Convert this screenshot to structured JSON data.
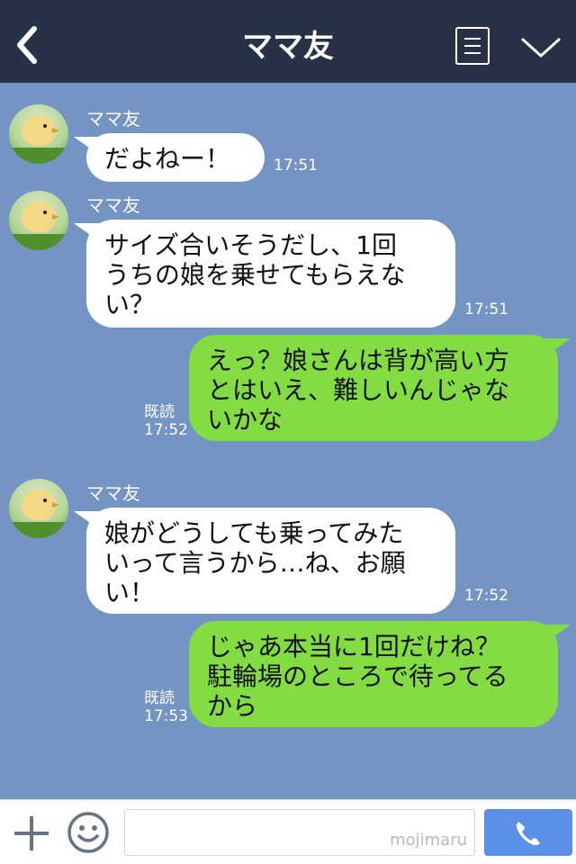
{
  "header": {
    "title": "ママ友",
    "back_icon": "chevron-left-icon",
    "menu_icon": "note-icon",
    "collapse_icon": "chevron-down-icon"
  },
  "messages": [
    {
      "sender": "ママ友",
      "lines": [
        "だよねー！"
      ],
      "time": "17:51"
    },
    {
      "sender": "ママ友",
      "lines": [
        "サイズ合いそうだし、1回",
        "うちの娘を乗せてもらえな",
        "い？"
      ],
      "time": "17:51"
    },
    {
      "read": "既読",
      "lines": [
        "えっ？娘さんは背が高い方",
        "とはいえ、難しいんじゃな",
        "いかな"
      ],
      "time": "17:52"
    },
    {
      "sender": "ママ友",
      "lines": [
        "娘がどうしても乗ってみた",
        "いって言うから…ね、お願",
        "い！"
      ],
      "time": "17:52"
    },
    {
      "read": "既読",
      "lines": [
        "じゃあ本当に1回だけね？",
        "駐輪場のところで待ってる",
        "から"
      ],
      "time": "17:53"
    }
  ],
  "input_bar": {
    "plus_icon": "plus-icon",
    "emoji_icon": "smiley-icon",
    "watermark": "mojimaru",
    "call_icon": "phone-icon"
  },
  "colors": {
    "header_bg": "#273246",
    "chat_bg": "#7494c4",
    "outgoing_bubble": "#82dc42",
    "incoming_bubble": "#ffffff",
    "call_button": "#5b8fe8"
  }
}
